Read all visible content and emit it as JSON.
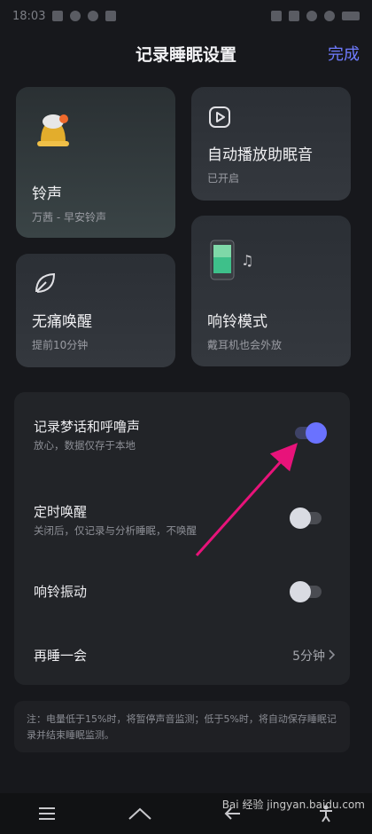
{
  "status_bar": {
    "time": "18:03"
  },
  "header": {
    "title": "记录睡眠设置",
    "done_label": "完成"
  },
  "cards": {
    "ringtone": {
      "title": "铃声",
      "subtitle": "万茜 - 早安铃声"
    },
    "auto_play": {
      "title": "自动播放助眠音",
      "subtitle": "已开启"
    },
    "painless_wake": {
      "title": "无痛唤醒",
      "subtitle": "提前10分钟"
    },
    "ring_mode": {
      "title": "响铃模式",
      "subtitle": "戴耳机也会外放"
    }
  },
  "settings": {
    "record_talk": {
      "title": "记录梦话和呼噜声",
      "subtitle": "放心，数据仅存于本地",
      "enabled": true
    },
    "timed_wake": {
      "title": "定时唤醒",
      "subtitle": "关闭后，仅记录与分析睡眠，不唤醒",
      "enabled": false
    },
    "ring_vibrate": {
      "title": "响铃振动",
      "enabled": false
    },
    "snooze": {
      "title": "再睡一会",
      "value": "5分钟"
    }
  },
  "note": "注：电量低于15%时，将暂停声音监测；低于5%时，将自动保存睡眠记录并结束睡眠监测。",
  "watermark": "Bai 经验 jingyan.baidu.com",
  "colors": {
    "accent": "#6f7bff",
    "toggle_on": "#6a72ff",
    "annotation_arrow": "#e8137a"
  }
}
